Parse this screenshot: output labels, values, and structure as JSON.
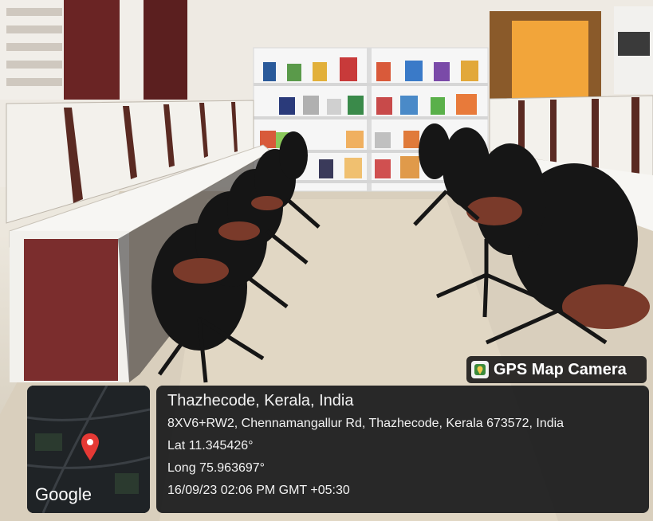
{
  "badge": {
    "label": "GPS Map Camera",
    "icon": "gps-map-camera-icon"
  },
  "map": {
    "logo_text": "Google",
    "pin_icon": "location-pin-icon"
  },
  "location": {
    "title": "Thazhecode, Kerala, India",
    "address": "8XV6+RW2, Chennamangallur Rd, Thazhecode, Kerala 673572, India",
    "latitude": "Lat 11.345426°",
    "longitude": "Long 75.963697°",
    "timestamp": "16/09/23 02:06 PM GMT +05:30"
  },
  "colors": {
    "overlay": "#111417",
    "pin": "#e53935",
    "desk_panel": "#7b2d2d",
    "shelf": "#f4f4f4"
  }
}
